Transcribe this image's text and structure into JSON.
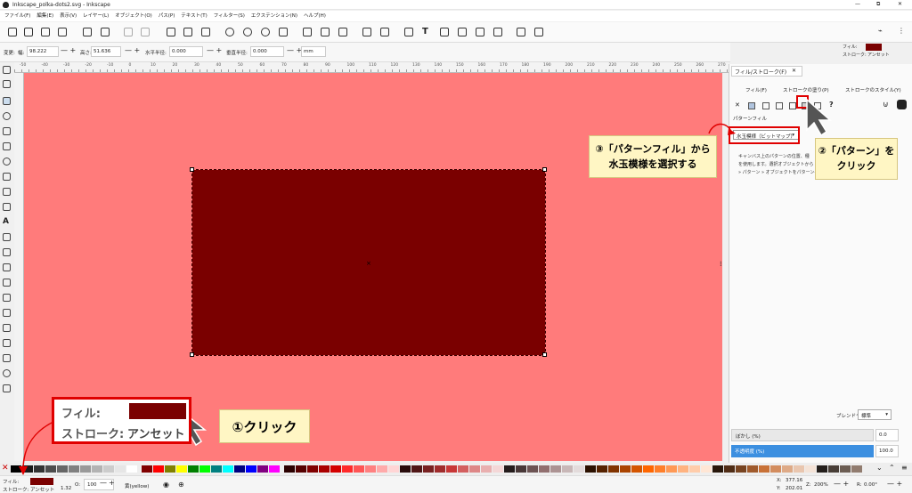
{
  "window": {
    "title": "Inkscape_polka-dots2.svg - Inkscape",
    "min": "—",
    "max": "⧉",
    "close": "✕"
  },
  "menu": [
    "ファイル(F)",
    "編集(E)",
    "表示(V)",
    "レイヤー(L)",
    "オブジェクト(O)",
    "パス(P)",
    "テキスト(T)",
    "フィルター(S)",
    "エクステンション(N)",
    "ヘルプ(H)"
  ],
  "header_style": {
    "fill_label": "フィル:",
    "stroke_label": "ストローク:",
    "stroke_value": "アンセット",
    "fill_color": "#7a0000"
  },
  "controls": {
    "change_label": "変更:",
    "w_label": "幅:",
    "w_value": "98.222",
    "h_label": "高さ:",
    "h_value": "51.636",
    "rx_label": "水平半径:",
    "rx_value": "0.000",
    "ry_label": "垂直半径:",
    "ry_value": "0.000",
    "unit": "mm"
  },
  "ruler_numbers": [
    "-50",
    "-40",
    "-30",
    "-20",
    "-10",
    "0",
    "10",
    "20",
    "30",
    "40",
    "50",
    "60",
    "70",
    "80",
    "90",
    "100",
    "110",
    "120",
    "130",
    "140",
    "150",
    "160",
    "170",
    "180",
    "190",
    "200",
    "210",
    "220",
    "230",
    "240",
    "250",
    "260",
    "270"
  ],
  "panel": {
    "tab_title": "フィル/ストローク(F)",
    "tab_close": "✕",
    "subtabs": [
      "フィル(F)",
      "ストロークの塗り(P)",
      "ストロークのスタイル(Y)"
    ],
    "fill_x": "✕",
    "unknown_button": "?",
    "pattern_label": "パターンフィル",
    "pattern_select": "水玉模様（ビットマップ）",
    "pattern_desc": [
      "キャンバス上のパターンの位置、種",
      "を使用します。選択オブジェクトから",
      "» パターン » オブジェクトをパターンへ"
    ],
    "blend_label": "ブレンドモード:",
    "blend_value": "標準",
    "blur_label": "ぼかし (%)",
    "blur_value": "0.0",
    "opacity_label": "不透明度 (%)",
    "opacity_value": "100.0"
  },
  "canvas": {
    "background": "#ff7b7b",
    "rect_color": "#7a0000"
  },
  "palette_colors": [
    "#000000",
    "#1a1a1a",
    "#333333",
    "#4d4d4d",
    "#666666",
    "#808080",
    "#999999",
    "#b3b3b3",
    "#cccccc",
    "#e6e6e6",
    "#ffffff",
    "#800000",
    "#ff0000",
    "#808000",
    "#ffff00",
    "#008000",
    "#00ff00",
    "#008080",
    "#00ffff",
    "#000080",
    "#0000ff",
    "#800080",
    "#ff00ff",
    "#2b0000",
    "#550000",
    "#800000",
    "#aa0000",
    "#d40000",
    "#ff2a2a",
    "#ff5555",
    "#ff8080",
    "#ffaaaa",
    "#ffd5d5",
    "#280b0b",
    "#501616",
    "#782121",
    "#a02c2c",
    "#c83737",
    "#d35f5f",
    "#de8787",
    "#e9afaf",
    "#f4d7d7",
    "#241c1c",
    "#483737",
    "#6c5353",
    "#916f6f",
    "#ac9393",
    "#c8b7b7",
    "#e3dbdb",
    "#2b1100",
    "#552200",
    "#803300",
    "#aa4400",
    "#d45500",
    "#ff6600",
    "#ff7f2a",
    "#ff9955",
    "#ffb380",
    "#ffccaa",
    "#ffe6d5",
    "#28170b",
    "#502d16",
    "#784421",
    "#a05a2c",
    "#c87137",
    "#d38d5f",
    "#deaa87",
    "#e9c6af",
    "#f4e3d7",
    "#241f1c",
    "#483e37",
    "#6c5d53",
    "#917c6f"
  ],
  "status": {
    "fill_label": "フィル:",
    "stroke_label": "ストローク:",
    "stroke_value": "アンセット",
    "stroke_width": "1.32",
    "opacity_label": "O:",
    "opacity_value": "100",
    "layer": "黄(yellow)",
    "x_label": "X:",
    "x_value": "377.16",
    "y_label": "Y:",
    "y_value": "202.01",
    "zoom_label": "Z:",
    "zoom_value": "200%",
    "rot_label": "R:",
    "rot_value": "0.00°"
  },
  "annotations": {
    "callout1": "①クリック",
    "callout2_line1": "②「パターン」を",
    "callout2_line2": "クリック",
    "callout3_line1": "③「パターンフィル」から",
    "callout3_line2": "水玉模様を選択する",
    "zoom_fill": "フィル:",
    "zoom_stroke": "ストローク:",
    "zoom_unset": "アンセット"
  }
}
